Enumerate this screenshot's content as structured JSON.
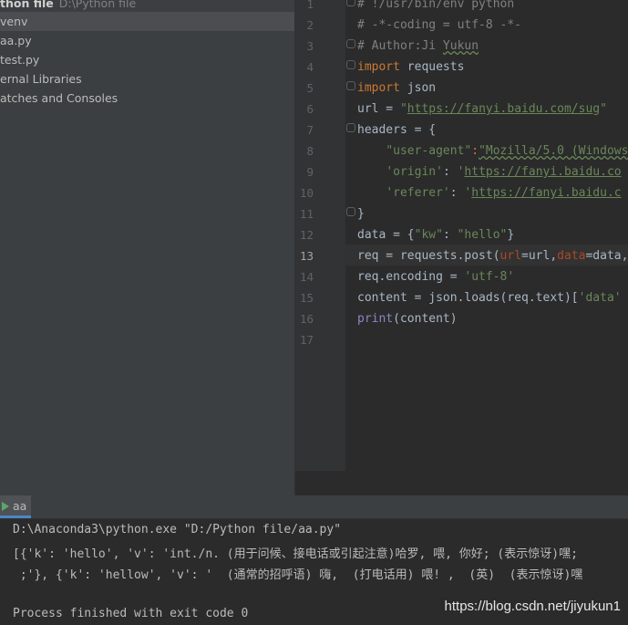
{
  "project": {
    "title": "thon file",
    "path": "D:\\Python file",
    "items": [
      {
        "label": "venv",
        "selected": true
      },
      {
        "label": "aa.py",
        "selected": false
      },
      {
        "label": "test.py",
        "selected": false
      },
      {
        "label": "ernal Libraries",
        "selected": false
      },
      {
        "label": "atches and Consoles",
        "selected": false
      }
    ]
  },
  "editor": {
    "line_numbers": [
      "1",
      "2",
      "3",
      "4",
      "5",
      "6",
      "7",
      "8",
      "9",
      "10",
      "11",
      "12",
      "13",
      "14",
      "15",
      "16",
      "17"
    ],
    "current_line": "13",
    "code": {
      "l1": "# !/usr/bin/env python",
      "l2": "# -*-coding = utf-8 -*-",
      "l3_a": "# Author:Ji ",
      "l3_b": "Yukun",
      "l4_kw": "import",
      "l4_rest": " requests",
      "l5_kw": "import",
      "l5_rest": " json",
      "l6_a": "url = ",
      "l6_q1": "\"",
      "l6_url": "https://fanyi.baidu.com/sug",
      "l6_q2": "\"",
      "l7": "headers = {",
      "l8_key": "\"user-agent\"",
      "l8_colon": ":",
      "l8_val": "\"Mozilla/5.0 (Windows",
      "l9_key": "'origin'",
      "l9_mid": ": ",
      "l9_q": "'",
      "l9_url": "https://fanyi.baidu.co",
      "l10_key": "'referer'",
      "l10_mid": ": ",
      "l10_q": "'",
      "l10_url": "https://fanyi.baidu.c",
      "l11": "}",
      "l12_a": "data = {",
      "l12_k": "\"kw\"",
      "l12_c": ": ",
      "l12_v": "\"hello\"",
      "l12_e": "}",
      "l13_a": "req = requests.post(",
      "l13_p1": "url",
      "l13_b": "=url,",
      "l13_p2": "data",
      "l13_c": "=data,",
      "l14_a": "req.encoding = ",
      "l14_s": "'utf-8'",
      "l15_a": "content = json.loads(req.text)[",
      "l15_s": "'data'",
      "l16_fn": "print",
      "l16_rest": "(content)"
    }
  },
  "run": {
    "tab_label": "aa",
    "console": [
      "D:\\Anaconda3\\python.exe \"D:/Python file/aa.py\"",
      "[{'k': 'hello', 'v': 'int./n. (用于问候、接电话或引起注意)哈罗, 喂, 你好; (表示惊讶)嘿;",
      " ;'}, {'k': 'hellow', 'v': '  (通常的招呼语) 嗨,  (打电话用) 喂! ,  (英)  (表示惊讶)嘿",
      "",
      "Process finished with exit code 0"
    ]
  },
  "watermark": "https://blog.csdn.net/jiyukun1",
  "colors": {
    "background": "#2b2b2b",
    "panel": "#3c3f41",
    "keyword": "#cc7832",
    "string": "#6a8759",
    "link": "#287bde",
    "comment": "#808080"
  }
}
